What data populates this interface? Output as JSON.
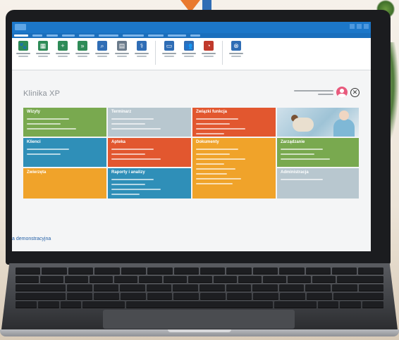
{
  "window": {
    "title": ""
  },
  "ribbon": {
    "buttons": [
      {
        "icon": "paw-icon",
        "color": "#2e8b57"
      },
      {
        "icon": "calendar-icon",
        "color": "#2e8b57"
      },
      {
        "icon": "new-visit-icon",
        "color": "#2e8b57"
      },
      {
        "icon": "quick-visit-icon",
        "color": "#2e8b57"
      },
      {
        "icon": "search-icon",
        "color": "#2f6db5"
      },
      {
        "icon": "calendar-grid-icon",
        "color": "#6a7a8a"
      },
      {
        "icon": "stethoscope-icon",
        "color": "#2f6db5"
      },
      {
        "icon": "document-icon",
        "color": "#2f6db5"
      },
      {
        "icon": "users-icon",
        "color": "#2f6db5"
      },
      {
        "icon": "pie-chart-icon",
        "color": "#c0392b"
      },
      {
        "icon": "logout-icon",
        "color": "#2f6db5"
      }
    ]
  },
  "app": {
    "heading": "Klinika XP"
  },
  "user": {
    "name": ""
  },
  "tiles": [
    {
      "id": "wizyty",
      "title": "Wizyty",
      "color": "#79a94f",
      "lines": 3
    },
    {
      "id": "terminarz",
      "title": "Terminarz",
      "color": "#b8c7cf",
      "lines": 3
    },
    {
      "id": "zwiazki",
      "title": "Związki funkcja",
      "color": "#e2572f",
      "lines": 4
    },
    {
      "id": "photo",
      "title": "",
      "color": "#cfe0ea",
      "lines": 0
    },
    {
      "id": "klienci",
      "title": "Klienci",
      "color": "#2f8fb8",
      "lines": 2
    },
    {
      "id": "apteka",
      "title": "Apteka",
      "color": "#e2572f",
      "lines": 3
    },
    {
      "id": "dokumenty",
      "title": "Dokumenty",
      "color": "#f0a32a",
      "lines": 8
    },
    {
      "id": "zarzadzanie",
      "title": "Zarządzanie",
      "color": "#79a94f",
      "lines": 3
    },
    {
      "id": "zwierzeta",
      "title": "Zwierzęta",
      "color": "#f0a32a",
      "lines": 0
    },
    {
      "id": "raporty",
      "title": "Raporty i analizy",
      "color": "#2f8fb8",
      "lines": 4
    },
    {
      "id": "administracja",
      "title": "Administracja",
      "color": "#b8c7cf",
      "lines": 1
    }
  ],
  "footer": {
    "text": "a demonstracyjna"
  }
}
